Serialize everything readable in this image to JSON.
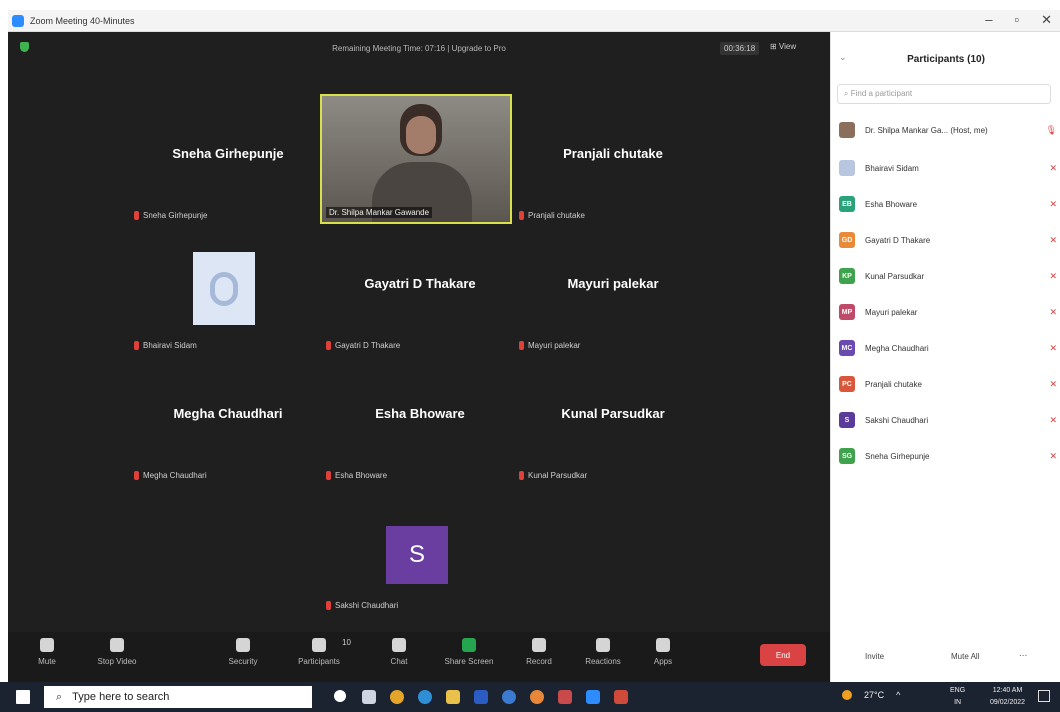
{
  "window": {
    "title": "Zoom Meeting 40-Minutes",
    "controls": [
      "–",
      "▫",
      "✕"
    ]
  },
  "meeting": {
    "remaining_text": "Remaining Meeting Time: 07:16 | Upgrade to Pro",
    "elapsed": "00:36:18",
    "view_label": "⊞ View"
  },
  "tiles": {
    "sneha_big": "Sneha Girhepunje",
    "sneha_small": "Sneha Girhepunje",
    "host_video_label": "Dr. Shilpa Mankar Gawande",
    "pranjali_big": "Pranjali chutake",
    "pranjali_small": "Pranjali chutake",
    "bhairavi_small": "Bhairavi Sidam",
    "gayatri_big": "Gayatri D Thakare",
    "gayatri_small": "Gayatri D Thakare",
    "mayuri_big": "Mayuri palekar",
    "mayuri_small": "Mayuri palekar",
    "megha_big": "Megha Chaudhari",
    "megha_small": "Megha Chaudhari",
    "esha_big": "Esha Bhoware",
    "esha_small": "Esha Bhoware",
    "kunal_big": "Kunal Parsudkar",
    "kunal_small": "Kunal Parsudkar",
    "sakshi_initial": "S",
    "sakshi_small": "Sakshi Chaudhari"
  },
  "toolbar": {
    "mute": "Mute",
    "stop_video": "Stop Video",
    "security": "Security",
    "participants": "Participants",
    "participants_count": "10",
    "chat": "Chat",
    "share_screen": "Share Screen",
    "record": "Record",
    "reactions": "Reactions",
    "apps": "Apps",
    "end": "End"
  },
  "panel": {
    "title": "Participants (10)",
    "search_placeholder": "Find a participant",
    "participants": [
      {
        "initials": "",
        "name": "Dr. Shilpa Mankar Ga... (Host, me)",
        "color": "#8b6f5c"
      },
      {
        "initials": "",
        "name": "Bhairavi Sidam",
        "color": "#b8c6df"
      },
      {
        "initials": "EB",
        "name": "Esha Bhoware",
        "color": "#2aa27a"
      },
      {
        "initials": "GD",
        "name": "Gayatri D Thakare",
        "color": "#e88a3a"
      },
      {
        "initials": "KP",
        "name": "Kunal Parsudkar",
        "color": "#3fa34d"
      },
      {
        "initials": "MP",
        "name": "Mayuri palekar",
        "color": "#c04a6a"
      },
      {
        "initials": "MC",
        "name": "Megha Chaudhari",
        "color": "#6a4ab0"
      },
      {
        "initials": "PC",
        "name": "Pranjali chutake",
        "color": "#d9573a"
      },
      {
        "initials": "S",
        "name": "Sakshi Chaudhari",
        "color": "#5a3a9a"
      },
      {
        "initials": "SG",
        "name": "Sneha Girhepunje",
        "color": "#3fa34d"
      }
    ],
    "invite": "Invite",
    "mute_all": "Mute All",
    "more": "..."
  },
  "taskbar": {
    "search_placeholder": "Type here to search",
    "temperature": "27°C",
    "language_line1": "ENG",
    "language_line2": "IN",
    "time": "12:40 AM",
    "date": "09/02/2022"
  },
  "colors": {
    "meeting_bg": "#1f1f1f",
    "active_speaker_border": "#d8e04a",
    "end_button": "#d94343",
    "mic_muted": "#e0403a"
  }
}
